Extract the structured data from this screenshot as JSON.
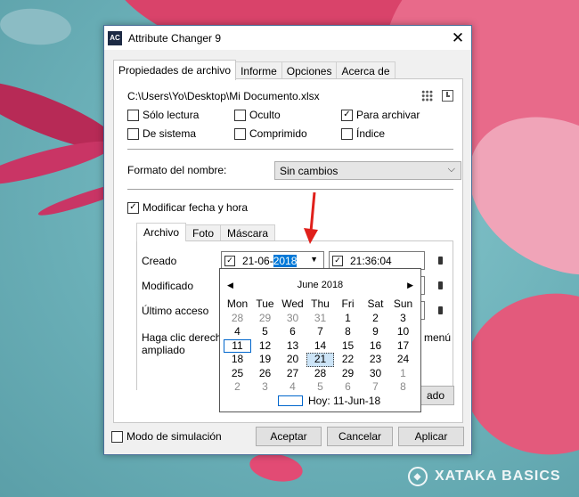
{
  "window": {
    "title": "Attribute Changer 9",
    "app_icon_text": "AC"
  },
  "tabs": [
    "Propiedades de archivo",
    "Informe",
    "Opciones",
    "Acerca de"
  ],
  "file_path": "C:\\Users\\Yo\\Desktop\\Mi Documento.xlsx",
  "attributes": {
    "solo_lectura": "Sólo lectura",
    "oculto": "Oculto",
    "para_archivar": "Para archivar",
    "de_sistema": "De sistema",
    "comprimido": "Comprimido",
    "indice": "Índice"
  },
  "name_format": {
    "label": "Formato del nombre:",
    "value": "Sin cambios"
  },
  "modify_date": {
    "label": "Modificar fecha y hora"
  },
  "inner_tabs": [
    "Archivo",
    "Foto",
    "Máscara"
  ],
  "fields": {
    "creado": "Creado",
    "modificado": "Modificado",
    "ultimo_acceso": "Último acceso",
    "date_prefix": "21-06-",
    "date_selected": "2018",
    "time": "21:36:04"
  },
  "hint": {
    "line1": "Haga clic derecho",
    "line2": "ampliado",
    "menu_suffix": "menú",
    "button_suffix": "ado"
  },
  "calendar": {
    "month_label": "June 2018",
    "weekdays": [
      "Mon",
      "Tue",
      "Wed",
      "Thu",
      "Fri",
      "Sat",
      "Sun"
    ],
    "days": [
      [
        "28",
        "29",
        "30",
        "31",
        "1",
        "2",
        "3"
      ],
      [
        "4",
        "5",
        "6",
        "7",
        "8",
        "9",
        "10"
      ],
      [
        "11",
        "12",
        "13",
        "14",
        "15",
        "16",
        "17"
      ],
      [
        "18",
        "19",
        "20",
        "21",
        "22",
        "23",
        "24"
      ],
      [
        "25",
        "26",
        "27",
        "28",
        "29",
        "30",
        "1"
      ],
      [
        "2",
        "3",
        "4",
        "5",
        "6",
        "7",
        "8"
      ]
    ],
    "today_label": "Hoy: 11-Jun-18"
  },
  "bottom": {
    "simulation": "Modo de simulación",
    "accept": "Aceptar",
    "cancel": "Cancelar",
    "apply": "Aplicar"
  },
  "watermark": "XATAKA BASICS",
  "colors": {
    "selection": "#0078d7",
    "arrow": "#e0201b",
    "today_outline": "#0066cc"
  }
}
